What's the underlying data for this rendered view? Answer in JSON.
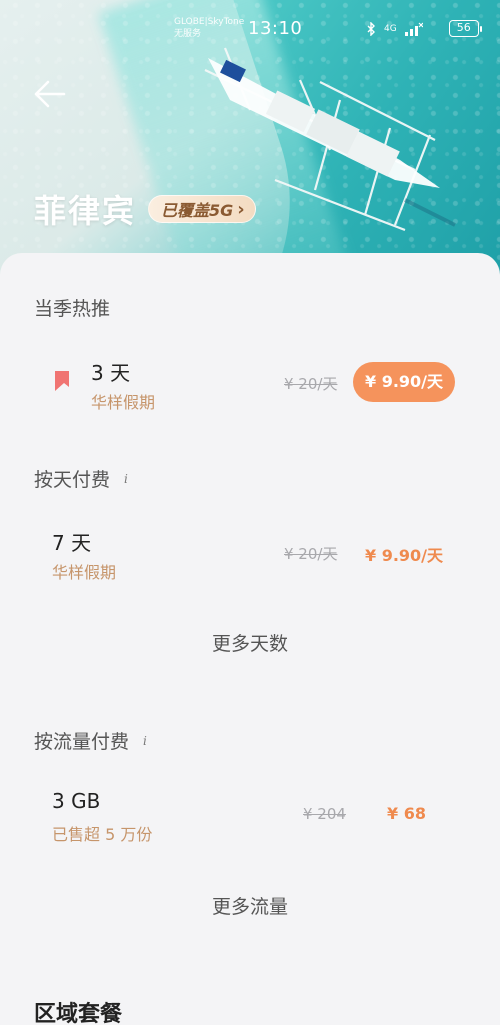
{
  "status_bar": {
    "carrier_line1": "GLOBE|SkyTone",
    "carrier_line2": "无服务",
    "time": "13:10",
    "network": "4G",
    "battery": "56"
  },
  "header": {
    "country": "菲律宾",
    "coverage_badge": "已覆盖5G",
    "coverage_chevron": "›"
  },
  "sections": {
    "seasonal": {
      "title": "当季热推",
      "plan": {
        "days": "3 天",
        "tag": "华样假期",
        "original_price": "¥ 20/天",
        "price": "¥ 9.90/天"
      }
    },
    "daily": {
      "title": "按天付费",
      "info": "i",
      "plan": {
        "days": "7 天",
        "tag": "华样假期",
        "original_price": "¥ 20/天",
        "price": "¥ 9.90/天"
      },
      "more": "更多天数"
    },
    "data": {
      "title": "按流量付费",
      "info": "i",
      "plan": {
        "volume": "3 GB",
        "sold": "已售超 5 万份",
        "original_price": "¥ 204",
        "price": "¥ 68"
      },
      "more": "更多流量"
    },
    "region": {
      "title": "区域套餐"
    }
  },
  "colors": {
    "accent": "#f5935c",
    "price_text": "#ef8a4e",
    "tag_text": "#c6956b",
    "background": "#f4f4f6"
  },
  "icons": [
    "back-arrow-icon",
    "bluetooth-icon",
    "signal-icon",
    "battery-icon",
    "bookmark-icon",
    "info-icon"
  ]
}
